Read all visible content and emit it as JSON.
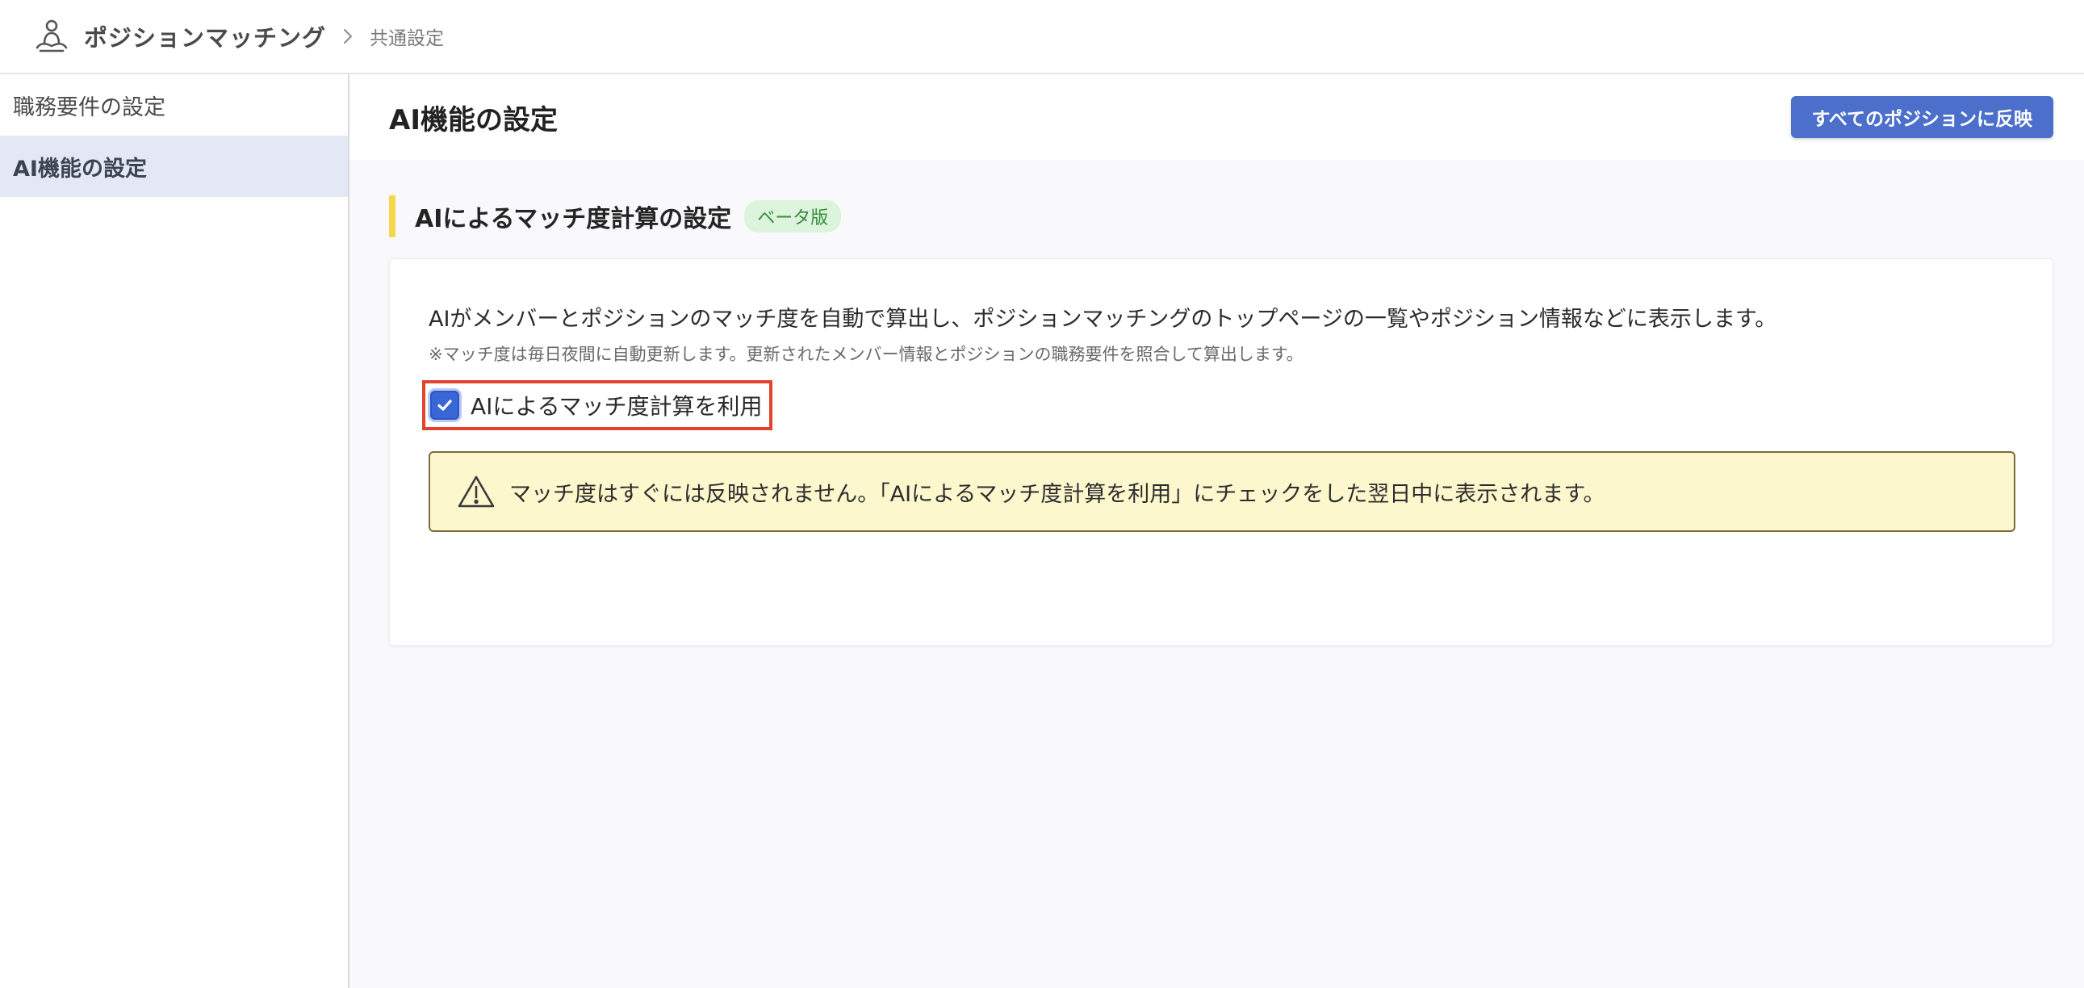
{
  "header": {
    "app_name": "ポジションマッチング",
    "breadcrumb_current": "共通設定"
  },
  "sidebar": {
    "items": [
      {
        "label": "職務要件の設定",
        "active": false
      },
      {
        "label": "AI機能の設定",
        "active": true
      }
    ]
  },
  "main": {
    "title": "AI機能の設定",
    "reflect_button": "すべてのポジションに反映",
    "section": {
      "title": "AIによるマッチ度計算の設定",
      "badge": "ベータ版",
      "description": "AIがメンバーとポジションのマッチ度を自動で算出し、ポジションマッチングのトップページの一覧やポジション情報などに表示します。",
      "note": "※マッチ度は毎日夜間に自動更新します。更新されたメンバー情報とポジションの職務要件を照合して算出します。",
      "checkbox": {
        "label": "AIによるマッチ度計算を利用",
        "checked": true
      },
      "warning": "マッチ度はすぐには反映されません。「AIによるマッチ度計算を利用」にチェックをした翌日中に表示されます。"
    }
  },
  "colors": {
    "accent": "#4b6fca",
    "sidebar_active_bg": "#e3e8f4",
    "section_bar": "#f6d64a",
    "badge_bg": "#dcf3dc",
    "badge_text": "#3b8b3f",
    "warning_bg": "#fdf7cd",
    "highlight_border": "#e2432b"
  },
  "icons": {
    "app": "person-meditation-icon",
    "breadcrumb": "chevron-right-icon",
    "checkbox": "check-icon",
    "warning": "warning-triangle-icon"
  }
}
